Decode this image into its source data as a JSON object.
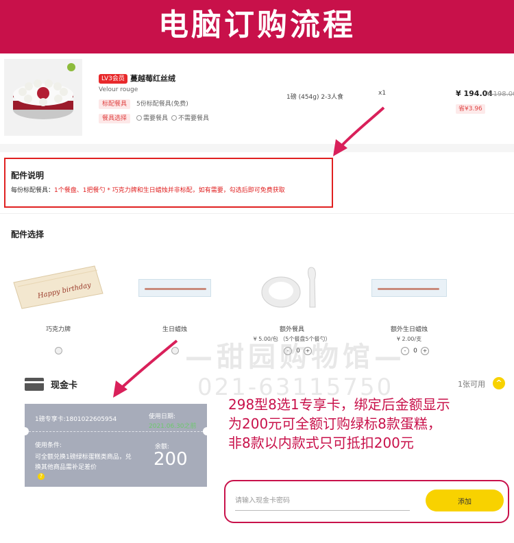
{
  "banner": {
    "title": "电脑订购流程",
    "color": "#c8114a"
  },
  "product": {
    "badge": "LV3会员",
    "name": "蔓越莓红丝绒",
    "english_name": "Velour rouge",
    "tag_tableware": "标配餐具",
    "tableware_desc": "5份标配餐具(免费)",
    "tag_select": "餐具选择",
    "option_need": "需要餐具",
    "option_no_need": "不需要餐具",
    "spec": "1磅 (454g) 2-3人食",
    "quantity": "x1",
    "price": "¥ 194.04",
    "old_price": "¥ 198.00",
    "save": "省¥3.96"
  },
  "accessory_info": {
    "title": "配件说明",
    "label": "每份标配餐具：",
    "desc": "1个餐盘、1把餐勺 * 巧克力牌和生日蜡烛并非标配，如有需要，勾选后即可免费获取"
  },
  "accessories": {
    "title": "配件选择",
    "items": [
      {
        "name": "巧克力牌",
        "price": "",
        "plaque_text": "Happy birthday"
      },
      {
        "name": "生日蜡烛",
        "price": ""
      },
      {
        "name": "额外餐具",
        "price": "¥ 5.00/包 （5个餐盘5个餐勺）",
        "count": "0"
      },
      {
        "name": "额外生日蜡烛",
        "price": "¥ 2.00/支",
        "count": "0"
      }
    ]
  },
  "watermark": {
    "line1": "—甜园购物馆—",
    "line2": "021-63115750"
  },
  "cash_card": {
    "title": "现金卡",
    "count_text": "1张可用",
    "card_no": "1磅专享卡:1801022605954",
    "date_label": "使用日期:",
    "date_value": "2021.06.30之前",
    "cond_label": "使用条件:",
    "cond_text": "可全额兑换1磅绿标蛋糕类商品，兑换其他商品需补足差价",
    "balance_label": "余额:",
    "balance": "200"
  },
  "promo_lines": [
    "298型8选1专享卡，绑定后金额显示",
    "为200元可全额订购绿标8款蛋糕，",
    "非8款以内款式只可抵扣200元"
  ],
  "code_input": {
    "placeholder": "请输入现金卡密码",
    "value": ""
  },
  "add_button": {
    "label": "添加"
  },
  "colors": {
    "accent": "#c8114a",
    "button_yellow": "#f8d200",
    "card_gray": "#a7acba",
    "red": "#e02020"
  }
}
